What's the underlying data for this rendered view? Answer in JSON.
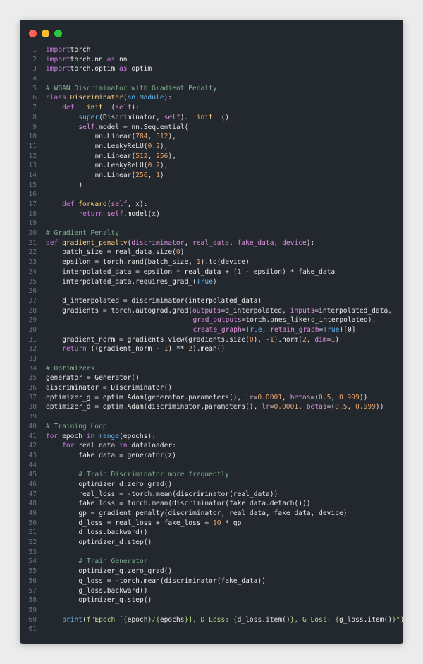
{
  "window": {
    "buttons": [
      {
        "name": "close",
        "color": "#ff5f57"
      },
      {
        "name": "minimize",
        "color": "#febc2e"
      },
      {
        "name": "maximize",
        "color": "#28c840"
      }
    ]
  },
  "code": {
    "lines": [
      [
        [
          "kw",
          "import"
        ],
        [
          "",
          "torch"
        ]
      ],
      [
        [
          "kw",
          "import"
        ],
        [
          "",
          "torch.nn "
        ],
        [
          "kw",
          "as"
        ],
        [
          "",
          ""
        ],
        [
          "",
          "nn"
        ]
      ],
      [
        [
          "kw",
          "import"
        ],
        [
          "",
          "torch.optim "
        ],
        [
          "kw",
          "as"
        ],
        [
          "",
          ""
        ],
        [
          "",
          "optim"
        ]
      ],
      [],
      [
        [
          "cm",
          "# WGAN Discriminator with Gradient Penalty"
        ]
      ],
      [
        [
          "kw",
          "class"
        ],
        [
          "",
          ""
        ],
        [
          "fn",
          "Discriminator"
        ],
        [
          "",
          "("
        ],
        [
          "bi",
          "nn.Module"
        ],
        [
          "",
          "):"
        ]
      ],
      [
        [
          "",
          ""
        ],
        [
          "kw",
          "def"
        ],
        [
          "",
          ""
        ],
        [
          "fn",
          "__init__"
        ],
        [
          "",
          "("
        ],
        [
          "pa",
          "self"
        ],
        [
          "",
          "):"
        ]
      ],
      [
        [
          "",
          ""
        ],
        [
          "bi",
          "super"
        ],
        [
          "",
          "(Discriminator, "
        ],
        [
          "pa",
          "self"
        ],
        [
          "",
          ")."
        ],
        [
          "fn",
          "__init__"
        ],
        [
          "",
          "()"
        ]
      ],
      [
        [
          "",
          ""
        ],
        [
          "pa",
          "self"
        ],
        [
          "",
          ".model = nn.Sequential("
        ]
      ],
      [
        [
          "",
          "nn.Linear("
        ],
        [
          "nm",
          "784"
        ],
        [
          "",
          ", "
        ],
        [
          "nm",
          "512"
        ],
        [
          "",
          "),"
        ]
      ],
      [
        [
          "",
          "nn.LeakyReLU("
        ],
        [
          "nm",
          "0.2"
        ],
        [
          "",
          "),"
        ]
      ],
      [
        [
          "",
          "nn.Linear("
        ],
        [
          "nm",
          "512"
        ],
        [
          "",
          ", "
        ],
        [
          "nm",
          "256"
        ],
        [
          "",
          "),"
        ]
      ],
      [
        [
          "",
          "nn.LeakyReLU("
        ],
        [
          "nm",
          "0.2"
        ],
        [
          "",
          "),"
        ]
      ],
      [
        [
          "",
          "nn.Linear("
        ],
        [
          "nm",
          "256"
        ],
        [
          "",
          ", "
        ],
        [
          "nm",
          "1"
        ],
        [
          "",
          ")"
        ]
      ],
      [
        [
          "",
          ")"
        ]
      ],
      [],
      [
        [
          "",
          ""
        ],
        [
          "kw",
          "def"
        ],
        [
          "",
          ""
        ],
        [
          "fn",
          "forward"
        ],
        [
          "",
          "("
        ],
        [
          "pa",
          "self"
        ],
        [
          "",
          ", x):"
        ]
      ],
      [
        [
          "",
          ""
        ],
        [
          "kw",
          "return"
        ],
        [
          "",
          ""
        ],
        [
          "pa",
          "self"
        ],
        [
          "",
          ".model(x)"
        ]
      ],
      [],
      [
        [
          "cm",
          "# Gradient Penalty"
        ]
      ],
      [
        [
          "kw",
          "def"
        ],
        [
          "",
          ""
        ],
        [
          "fn",
          "gradient_penalty"
        ],
        [
          "",
          "("
        ],
        [
          "pa",
          "discriminator"
        ],
        [
          "",
          ", "
        ],
        [
          "pa",
          "real_data"
        ],
        [
          "",
          ", "
        ],
        [
          "pa",
          "fake_data"
        ],
        [
          "",
          ", "
        ],
        [
          "pa",
          "device"
        ],
        [
          "",
          "):"
        ]
      ],
      [
        [
          "",
          "batch_size = real_data.size("
        ],
        [
          "nm",
          "0"
        ],
        [
          "",
          ")"
        ]
      ],
      [
        [
          "",
          "epsilon = torch.rand(batch_size, "
        ],
        [
          "nm",
          "1"
        ],
        [
          "",
          ").to(device)"
        ]
      ],
      [
        [
          "",
          "interpolated_data = epsilon * real_data + ("
        ],
        [
          "nm",
          "1"
        ],
        [
          "",
          ""
        ],
        [
          "",
          "- epsilon) * fake_data"
        ]
      ],
      [
        [
          "",
          "interpolated_data.requires_grad_("
        ],
        [
          "cs",
          "True"
        ],
        [
          "",
          ")"
        ]
      ],
      [],
      [
        [
          "",
          "d_interpolated = discriminator(interpolated_data)"
        ]
      ],
      [
        [
          "",
          "gradients = torch.autograd.grad("
        ],
        [
          "pa",
          "outputs"
        ],
        [
          "",
          "=d_interpolated, "
        ],
        [
          "pa",
          "inputs"
        ],
        [
          "",
          "=interpolated_data,"
        ]
      ],
      [
        [
          "pa",
          "grad_outputs"
        ],
        [
          "",
          "=torch.ones_like(d_interpolated),"
        ]
      ],
      [
        [
          "pa",
          "create_graph"
        ],
        [
          "",
          "="
        ],
        [
          "cs",
          "True"
        ],
        [
          "",
          ", "
        ],
        [
          "pa",
          "retain_graph"
        ],
        [
          "",
          "="
        ],
        [
          "cs",
          "True"
        ],
        [
          "",
          ")[0]"
        ]
      ],
      [
        [
          "",
          "gradient_norm = gradients.view(gradients.size("
        ],
        [
          "nm",
          "0"
        ],
        [
          "",
          "), -"
        ],
        [
          "nm",
          "1"
        ],
        [
          "",
          ").norm("
        ],
        [
          "nm",
          "2"
        ],
        [
          "",
          ", "
        ],
        [
          "pa",
          "dim"
        ],
        [
          "",
          "="
        ],
        [
          "nm",
          "1"
        ],
        [
          "",
          ")"
        ]
      ],
      [
        [
          "",
          ""
        ],
        [
          "kw",
          "return"
        ],
        [
          "",
          ""
        ],
        [
          "",
          "((gradient_norm - "
        ],
        [
          "nm",
          "1"
        ],
        [
          "",
          ") ** "
        ],
        [
          "nm",
          "2"
        ],
        [
          "",
          ").mean()"
        ]
      ],
      [],
      [
        [
          "cm",
          "# Optimizers"
        ]
      ],
      [
        [
          "",
          "generator = Generator()"
        ]
      ],
      [
        [
          "",
          "discriminator = Discriminator()"
        ]
      ],
      [
        [
          "",
          "optimizer_g = optim.Adam(generator.parameters(), "
        ],
        [
          "pa",
          "lr"
        ],
        [
          "",
          "="
        ],
        [
          "nm",
          "0.0001"
        ],
        [
          "",
          ", "
        ],
        [
          "pa",
          "betas"
        ],
        [
          "",
          "=("
        ],
        [
          "nm",
          "0.5"
        ],
        [
          "",
          ", "
        ],
        [
          "nm",
          "0.999"
        ],
        [
          "",
          "))"
        ]
      ],
      [
        [
          "",
          "optimizer_d = optim.Adam(discriminator.parameters(), "
        ],
        [
          "pa",
          "lr"
        ],
        [
          "",
          "="
        ],
        [
          "nm",
          "0.0001"
        ],
        [
          "",
          ", "
        ],
        [
          "pa",
          "betas"
        ],
        [
          "",
          "=("
        ],
        [
          "nm",
          "0.5"
        ],
        [
          "",
          ", "
        ],
        [
          "nm",
          "0.999"
        ],
        [
          "",
          "))"
        ]
      ],
      [],
      [
        [
          "cm",
          "# Training Loop"
        ]
      ],
      [
        [
          "kw",
          "for"
        ],
        [
          "",
          ""
        ],
        [
          "",
          "epoch "
        ],
        [
          "kw",
          "in"
        ],
        [
          "",
          ""
        ],
        [
          "bi",
          "range"
        ],
        [
          "",
          "(epochs):"
        ]
      ],
      [
        [
          "",
          ""
        ],
        [
          "kw",
          "for"
        ],
        [
          "",
          ""
        ],
        [
          "",
          "real_data "
        ],
        [
          "kw",
          "in"
        ],
        [
          "",
          ""
        ],
        [
          "",
          "dataloader:"
        ]
      ],
      [
        [
          "",
          "fake_data = generator(z)"
        ]
      ],
      [],
      [
        [
          "cm",
          "# Train Discriminator more frequently"
        ]
      ],
      [
        [
          "",
          "optimizer_d.zero_grad()"
        ]
      ],
      [
        [
          "",
          "real_loss = -torch.mean(discriminator(real_data))"
        ]
      ],
      [
        [
          "",
          "fake_loss = torch.mean(discriminator(fake_data.detach()))"
        ]
      ],
      [
        [
          "",
          "gp = gradient_penalty(discriminator, real_data, fake_data, device)"
        ]
      ],
      [
        [
          "",
          "d_loss = real_loss + fake_loss + "
        ],
        [
          "nm",
          "10"
        ],
        [
          "",
          ""
        ],
        [
          "",
          "* gp"
        ]
      ],
      [
        [
          "",
          "d_loss.backward()"
        ]
      ],
      [
        [
          "",
          "optimizer_d.step()"
        ]
      ],
      [],
      [
        [
          "cm",
          "# Train Generator"
        ]
      ],
      [
        [
          "",
          "optimizer_g.zero_grad()"
        ]
      ],
      [
        [
          "",
          "g_loss = -torch.mean(discriminator(fake_data))"
        ]
      ],
      [
        [
          "",
          "g_loss.backward()"
        ]
      ],
      [
        [
          "",
          "optimizer_g.step()"
        ]
      ],
      [],
      [
        [
          "",
          ""
        ],
        [
          "bi",
          "print"
        ],
        [
          "",
          "("
        ],
        [
          "st",
          "f\"Epoch [{"
        ],
        [
          "",
          "epoch"
        ],
        [
          "st",
          "}/{"
        ],
        [
          "",
          "epochs"
        ],
        [
          "st",
          "}], D Loss: {"
        ],
        [
          "",
          "d_loss.item()"
        ],
        [
          "st",
          "}, G Loss: {"
        ],
        [
          "",
          "g_loss.item()"
        ],
        [
          "st",
          "}\""
        ],
        [
          "",
          ")"
        ]
      ],
      []
    ]
  }
}
